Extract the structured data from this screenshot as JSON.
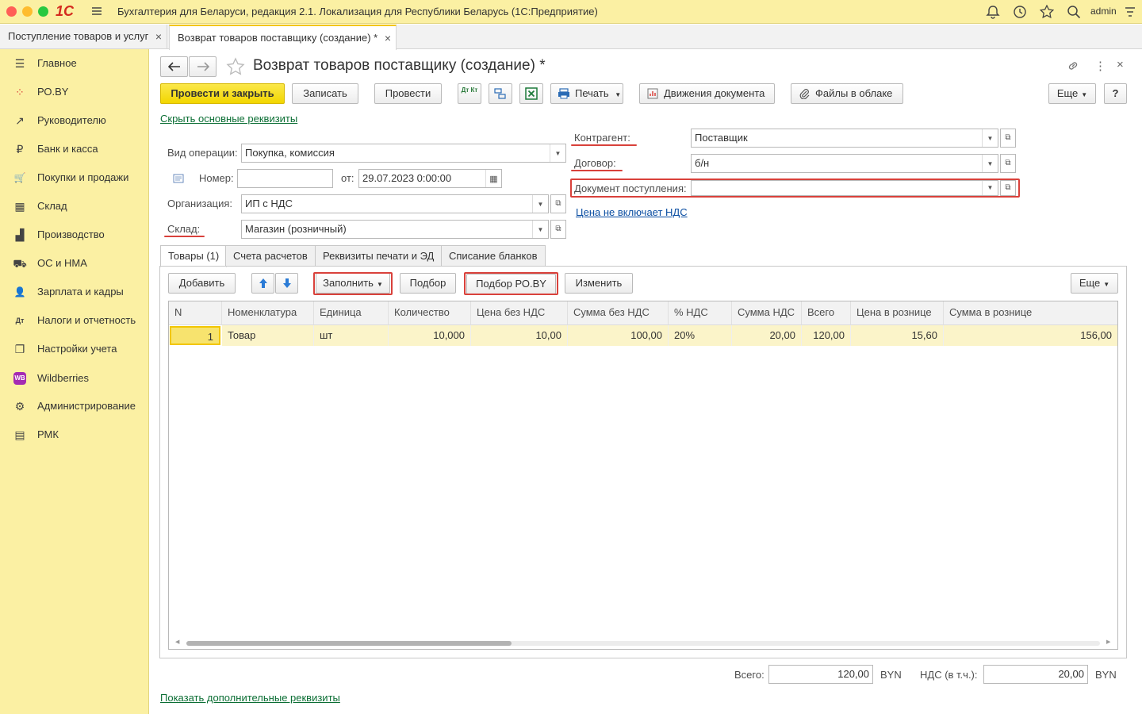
{
  "app": {
    "title": "Бухгалтерия для Беларуси, редакция 2.1. Локализация для Республики Беларусь   (1С:Предприятие)",
    "logo": "1С",
    "user": "admin"
  },
  "tabs": [
    {
      "label": "Поступление товаров и услуг",
      "close": "×"
    },
    {
      "label": "Возврат товаров поставщику (создание) *",
      "close": "×"
    }
  ],
  "sidebar": {
    "items": [
      {
        "label": "Главное",
        "icon": "☰"
      },
      {
        "label": "РО.BY",
        "icon": "⁘"
      },
      {
        "label": "Руководителю",
        "icon": "↗"
      },
      {
        "label": "Банк и касса",
        "icon": "₽"
      },
      {
        "label": "Покупки и продажи",
        "icon": "🛒"
      },
      {
        "label": "Склад",
        "icon": "▦"
      },
      {
        "label": "Производство",
        "icon": "▟"
      },
      {
        "label": "ОС и НМА",
        "icon": "⛟"
      },
      {
        "label": "Зарплата и кадры",
        "icon": "👤"
      },
      {
        "label": "Налоги и отчетность",
        "icon": "Дт"
      },
      {
        "label": "Настройки учета",
        "icon": "❐"
      },
      {
        "label": "Wildberries",
        "icon": "WB"
      },
      {
        "label": "Администрирование",
        "icon": "⚙"
      },
      {
        "label": "РМК",
        "icon": "▤"
      }
    ]
  },
  "form": {
    "title": "Возврат товаров поставщику (создание) *",
    "toolbar": {
      "post_close": "Провести и закрыть",
      "save": "Записать",
      "post": "Провести",
      "dtkt": "Дт Кт",
      "print": "Печать",
      "movements": "Движения документа",
      "cloud": "Файлы в облаке",
      "more": "Еще",
      "help": "?"
    },
    "hide_link": "Скрыть основные реквизиты",
    "operation_label": "Вид операции:",
    "operation_value": "Покупка, комиссия",
    "number_label": "Номер:",
    "number_value": "",
    "date_label": "от:",
    "date_value": "29.07.2023  0:00:00",
    "org_label": "Организация:",
    "org_value": "ИП с НДС",
    "warehouse_label": "Склад:",
    "warehouse_value": "Магазин (розничный)",
    "counterparty_label": "Контрагент:",
    "counterparty_value": "Поставщик",
    "contract_label": "Договор:",
    "contract_value": "б/н",
    "receipt_doc_label": "Документ поступления:",
    "receipt_doc_value": "",
    "vat_link": "Цена не включает НДС"
  },
  "form_tabs": [
    "Товары (1)",
    "Счета расчетов",
    "Реквизиты печати и ЭД",
    "Списание бланков"
  ],
  "table_toolbar": {
    "add": "Добавить",
    "fill": "Заполнить",
    "pick": "Подбор",
    "pick_roby": "Подбор РО.BY",
    "change": "Изменить",
    "more": "Еще"
  },
  "table": {
    "columns": [
      "N",
      "Номенклатура",
      "Единица",
      "Количество",
      "Цена без НДС",
      "Сумма без НДС",
      "% НДС",
      "Сумма НДС",
      "Всего",
      "Цена в рознице",
      "Сумма в рознице"
    ],
    "rows": [
      [
        "1",
        "Товар",
        "шт",
        "10,000",
        "10,00",
        "100,00",
        "20%",
        "20,00",
        "120,00",
        "15,60",
        "156,00"
      ]
    ]
  },
  "totals": {
    "total_label": "Всего:",
    "total_value": "120,00",
    "currency": "BYN",
    "vat_label": "НДС (в т.ч.):",
    "vat_value": "20,00",
    "currency2": "BYN"
  },
  "show_more_link": "Показать дополнительные реквизиты",
  "colors": {
    "accent_yellow": "#fbf0a3",
    "primary_button": "#f7e01b",
    "highlight_red": "#d9413b",
    "link_green": "#0b6e34"
  }
}
